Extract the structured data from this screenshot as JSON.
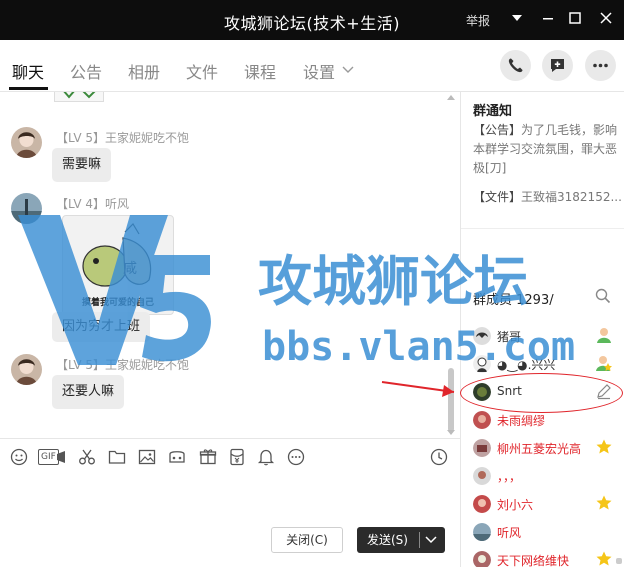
{
  "window": {
    "title": "攻城狮论坛(技术+生活)",
    "report": "举报"
  },
  "tabs": [
    {
      "label": "聊天",
      "active": true
    },
    {
      "label": "公告"
    },
    {
      "label": "相册"
    },
    {
      "label": "文件"
    },
    {
      "label": "课程"
    },
    {
      "label": "设置"
    }
  ],
  "chat": {
    "messages": [
      {
        "level": "【LV 5】",
        "name": "王家妮妮吃不饱",
        "text": "需要嘛"
      },
      {
        "level": "【LV 4】",
        "name": "听风",
        "sticker_caption": "摸着我可爱的自己",
        "sticker_char": "咸",
        "text": "因为穷才上班"
      },
      {
        "level": "【LV 5】",
        "name": "王家妮妮吃不饱",
        "text": "还要人嘛"
      }
    ]
  },
  "toolbar": {
    "gif": "GIF"
  },
  "buttons": {
    "close": "关闭(C)",
    "send": "发送(S)"
  },
  "notice": {
    "title": "群通知",
    "announcement_tag": "【公告】",
    "announcement_text": "为了几毛钱，影响本群学习交流氛围，罪大恶极[刀]",
    "file_tag": "【文件】",
    "file_text": "王致福3182152..."
  },
  "members": {
    "title": "群成员 1293/",
    "list": [
      {
        "name": "猪哥",
        "color": "#333333"
      },
      {
        "name": "◕‿◕.兴兴",
        "color": "#333333"
      },
      {
        "name": "Snrt",
        "color": "#333333"
      },
      {
        "name": "未雨绸缪",
        "color": "#e0252b"
      },
      {
        "name": "柳州五菱宏光高",
        "color": "#e0252b"
      },
      {
        "name": "，，，",
        "color": "#e0252b"
      },
      {
        "name": "刘小六",
        "color": "#e0252b"
      },
      {
        "name": "听风",
        "color": "#e0252b"
      },
      {
        "name": "天下网络维快",
        "color": "#e0252b"
      }
    ]
  },
  "watermark": {
    "name": "攻城狮论坛",
    "url": "bbs.vlan5.com"
  },
  "colors": {
    "titlebar": "#0d0d0d",
    "accent_red": "#e0252b",
    "watermark_blue": "#3a8fd4"
  }
}
